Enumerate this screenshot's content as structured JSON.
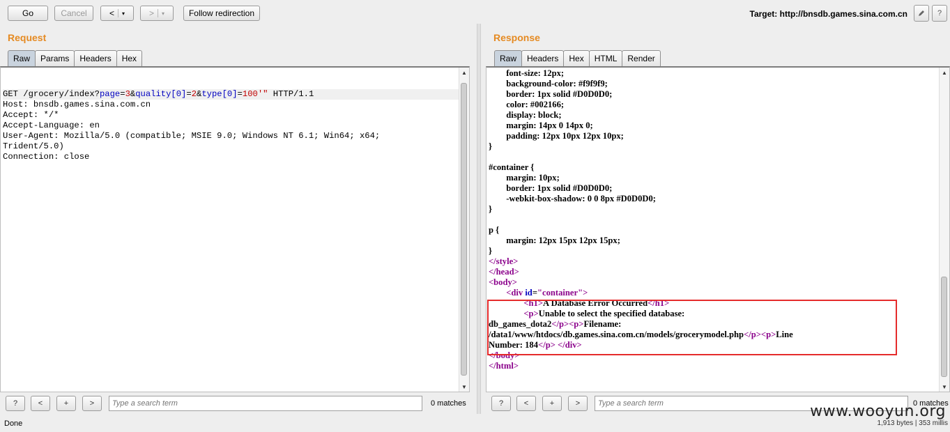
{
  "toolbar": {
    "go": "Go",
    "cancel": "Cancel",
    "back": "<",
    "forward": ">",
    "dropdown": "▾",
    "follow": "Follow redirection",
    "target": "Target: http://bnsdb.games.sina.com.cn"
  },
  "request": {
    "title": "Request",
    "tabs": [
      "Raw",
      "Params",
      "Headers",
      "Hex"
    ],
    "active_tab": "Raw",
    "line1": {
      "a": "GET /grocery/index?",
      "p1": "page",
      "eq1": "=",
      "v1": "3",
      "amp1": "&",
      "p2": "quality[0]",
      "eq2": "=",
      "v2": "2",
      "amp2": "&",
      "p3": "type[0]",
      "eq3": "=",
      "v3": "100'\"",
      "b": " HTTP/1.1"
    },
    "rest": "Host: bnsdb.games.sina.com.cn\nAccept: */*\nAccept-Language: en\nUser-Agent: Mozilla/5.0 (compatible; MSIE 9.0; Windows NT 6.1; Win64; x64;\nTrident/5.0)\nConnection: close",
    "search_placeholder": "Type a search term",
    "matches": "0 matches",
    "buttons": {
      "help": "?",
      "prev": "<",
      "add": "+",
      "next": ">"
    }
  },
  "response": {
    "title": "Response",
    "tabs": [
      "Raw",
      "Headers",
      "Hex",
      "HTML",
      "Render"
    ],
    "active_tab": "Raw",
    "css_block": "        font-size: 12px;\n        background-color: #f9f9f9;\n        border: 1px solid #D0D0D0;\n        color: #002166;\n        display: block;\n        margin: 14px 0 14px 0;\n        padding: 12px 10px 12px 10px;\n}\n\n#container {\n        margin: 10px;\n        border: 1px solid #D0D0D0;\n        -webkit-box-shadow: 0 0 8px #D0D0D0;\n}\n\np {\n        margin: 12px 15px 12px 15px;\n}",
    "tags": {
      "close_style": "</style>",
      "close_head": "</head>",
      "open_body": "<body>",
      "div_open_a": "        <div ",
      "div_attr": "id",
      "div_eq": "=",
      "div_val": "\"container\"",
      "div_close": ">",
      "h1_open": "<h1>",
      "h1_text": "A Database Error Occurred",
      "h1_close": "</h1>",
      "p_open": "<p>",
      "p1_text": "Unable to select the specified database:",
      "p1_text2": "db_games_dota2",
      "p_close": "</p>",
      "p2_text": "Filename:",
      "p2_text2": "/data1/www/htdocs/db.games.sina.com.cn/models/grocerymodel.php",
      "p3_text": "Line",
      "p3_text2": "Number: 184",
      "div_end": "</div>",
      "close_body": "</body>",
      "close_html": "</html>"
    },
    "search_placeholder": "Type a search term",
    "matches": "0 matches",
    "buttons": {
      "help": "?",
      "prev": "<",
      "add": "+",
      "next": ">"
    }
  },
  "status": {
    "left": "Done",
    "right": "1,913 bytes | 353 millis"
  },
  "watermark": "www.wooyun.org",
  "colors": {
    "section_title": "#e58a22",
    "highlight_box": "#e52b2b",
    "param": "#0000c0",
    "value": "#c00000",
    "tag": "#8b008b"
  }
}
